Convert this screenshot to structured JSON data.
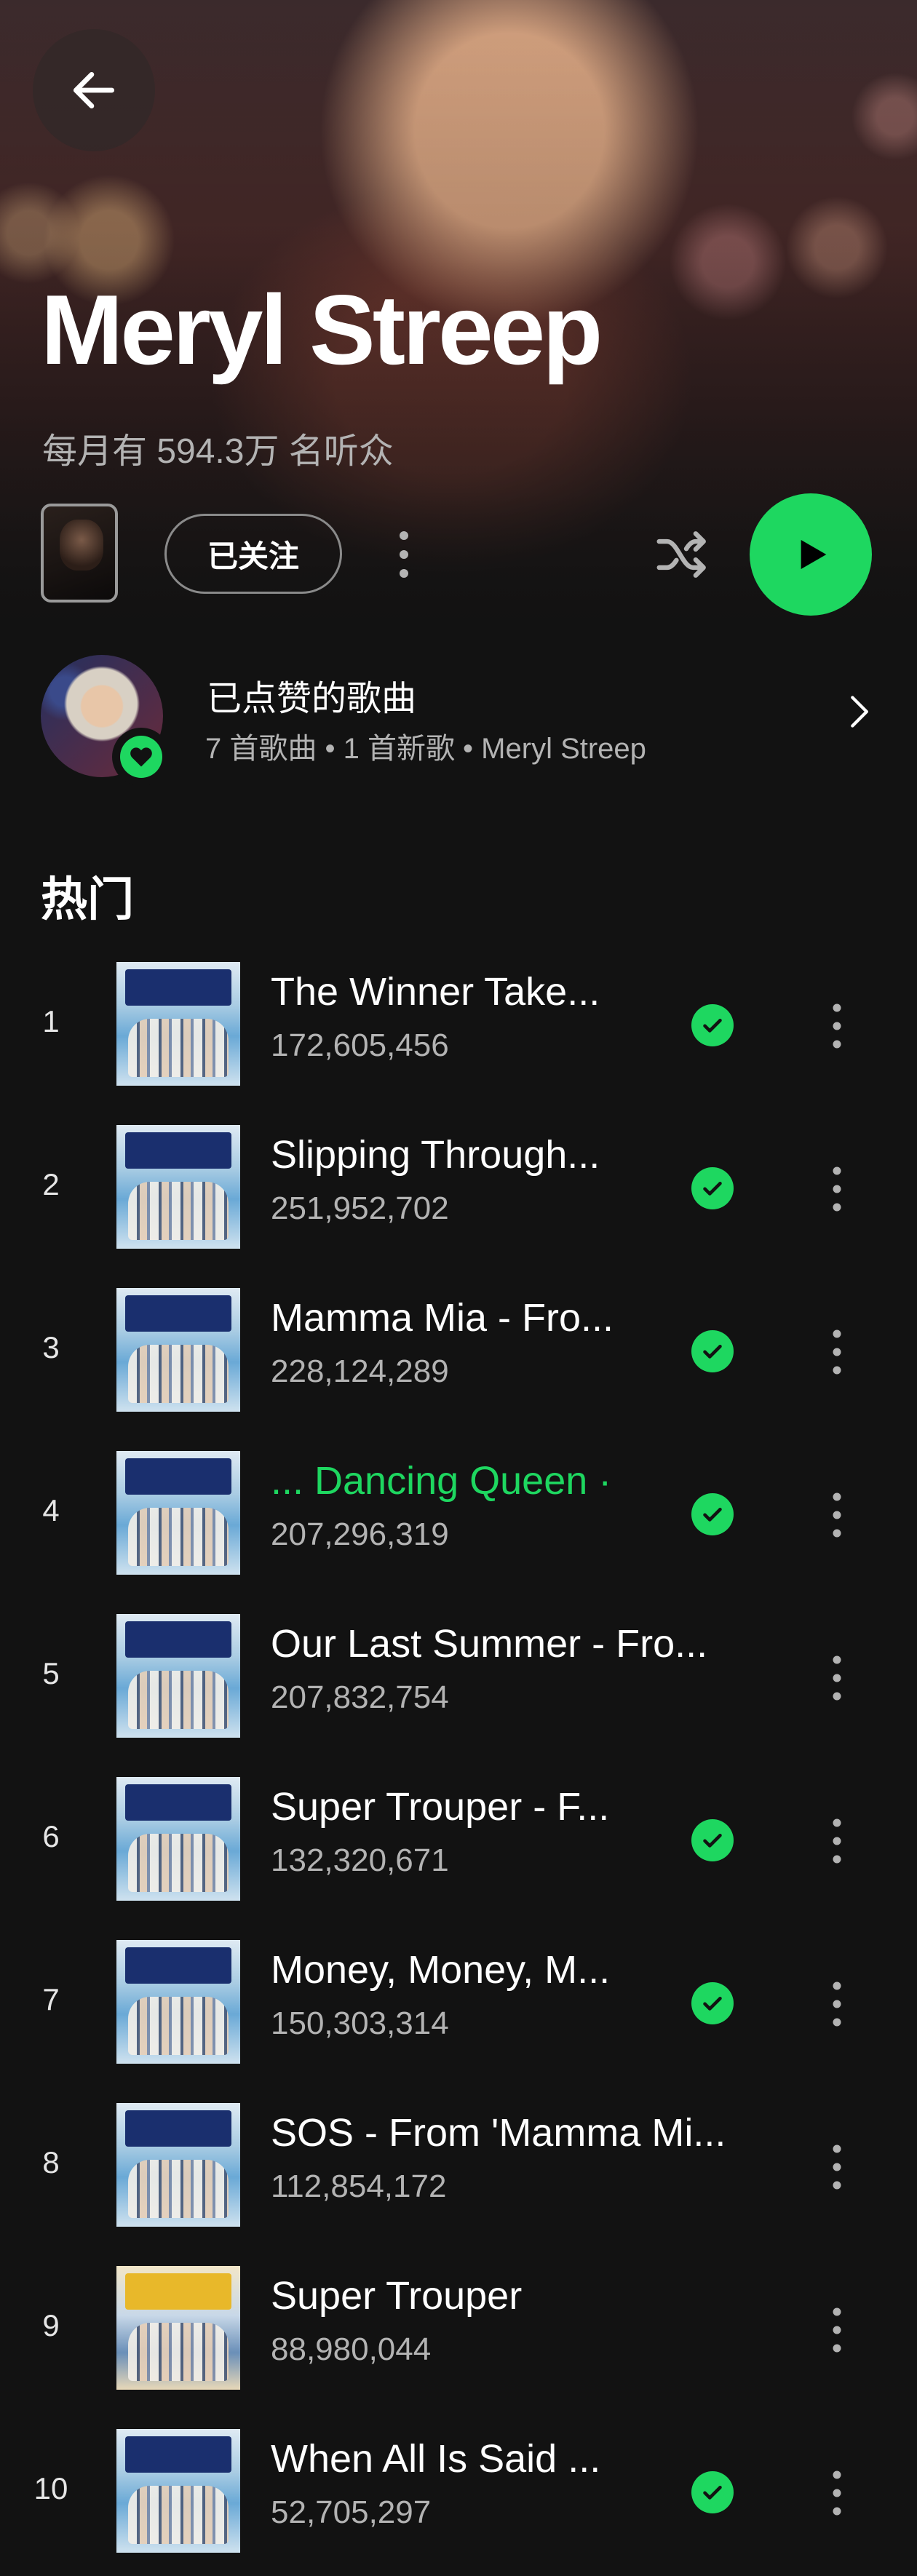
{
  "header": {
    "artist_name": "Meryl Streep",
    "monthly_listeners": "每月有 594.3万 名听众",
    "follow_label": "已关注",
    "accent_color": "#1ed760"
  },
  "icons": {
    "back": "arrow-left-icon",
    "more": "more-vertical-icon",
    "shuffle": "shuffle-icon",
    "play": "play-icon",
    "heart": "heart-icon",
    "chevron": "chevron-right-icon",
    "check": "check-icon"
  },
  "liked": {
    "title": "已点赞的歌曲",
    "subtitle": "7 首歌曲 • 1 首新歌 • Meryl Streep"
  },
  "popular": {
    "heading": "热门",
    "tracks": [
      {
        "rank": "1",
        "title": "The Winner Take...",
        "plays": "172,605,456",
        "saved": true
      },
      {
        "rank": "2",
        "title": "Slipping Through...",
        "plays": "251,952,702",
        "saved": true
      },
      {
        "rank": "3",
        "title": "Mamma Mia - Fro...",
        "plays": "228,124,289",
        "saved": true
      },
      {
        "rank": "4",
        "title": "... Dancing Queen ·",
        "plays": "207,296,319",
        "saved": true,
        "playing": true
      },
      {
        "rank": "5",
        "title": "Our Last Summer - Fro...",
        "plays": "207,832,754",
        "saved": false
      },
      {
        "rank": "6",
        "title": "Super Trouper - F...",
        "plays": "132,320,671",
        "saved": true
      },
      {
        "rank": "7",
        "title": "Money, Money, M...",
        "plays": "150,303,314",
        "saved": true
      },
      {
        "rank": "8",
        "title": "SOS - From 'Mamma Mi...",
        "plays": "112,854,172",
        "saved": false
      },
      {
        "rank": "9",
        "title": "Super Trouper",
        "plays": "88,980,044",
        "saved": false
      },
      {
        "rank": "10",
        "title": "When All Is Said ...",
        "plays": "52,705,297",
        "saved": true
      }
    ]
  }
}
